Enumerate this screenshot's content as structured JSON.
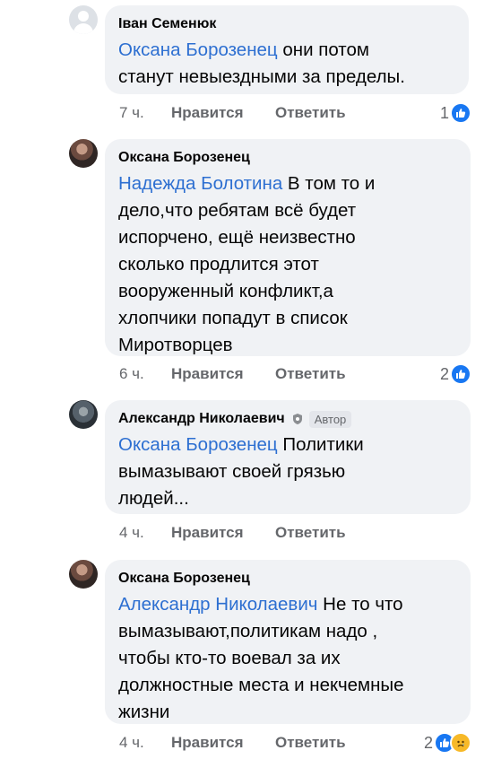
{
  "comments": [
    {
      "author": "Іван Семенюк",
      "mention": "Оксана Борозенец",
      "text_lines": [
        " они потом",
        "станут невыездными за пределы."
      ],
      "time": "7 ч.",
      "like_label": "Нравится",
      "reply_label": "Ответить",
      "reaction_count": "1",
      "reactions": [
        "like-icon"
      ]
    },
    {
      "author": "Оксана Борозенец",
      "mention": "Надежда Болотина",
      "text_lines": [
        " В том то и",
        "дело,что ребятам всё будет",
        "испорчено, ещё неизвестно",
        "сколько продлится этот",
        "вооруженный конфликт,а",
        "хлопчики попадут в список",
        "Миротворцев"
      ],
      "time": "6 ч.",
      "like_label": "Нравится",
      "reply_label": "Ответить",
      "reaction_count": "2",
      "reactions": [
        "like-icon"
      ]
    },
    {
      "author": "Александр Николаевич",
      "author_badge": "Автор",
      "mention": "Оксана Борозенец",
      "text_lines": [
        " Политики",
        "вымазывают своей грязью",
        "людей..."
      ],
      "time": "4 ч.",
      "like_label": "Нравится",
      "reply_label": "Ответить"
    },
    {
      "author": "Оксана Борозенец",
      "mention": "Александр Николаевич",
      "text_lines": "  Не то что|вымазывают,политикам надо ,|чтобы кто-то воевал за их|должностные места и некчемные|жизни",
      "time": "4 ч.",
      "like_label": "Нравится",
      "reply_label": "Ответить",
      "reaction_count": "2",
      "reactions": [
        "like-icon",
        "sad-icon"
      ]
    }
  ],
  "colors": {
    "mention": "#2d6fd1",
    "bubble": "#f0f2f5",
    "meta": "#65676b"
  }
}
